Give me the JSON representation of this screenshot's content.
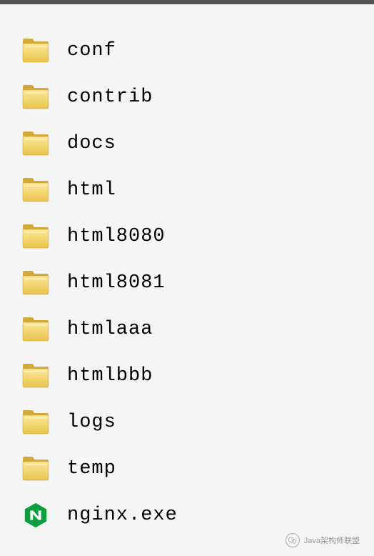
{
  "files": [
    {
      "name": "conf",
      "type": "folder"
    },
    {
      "name": "contrib",
      "type": "folder"
    },
    {
      "name": "docs",
      "type": "folder"
    },
    {
      "name": "html",
      "type": "folder"
    },
    {
      "name": "html8080",
      "type": "folder"
    },
    {
      "name": "html8081",
      "type": "folder"
    },
    {
      "name": "htmlaaa",
      "type": "folder"
    },
    {
      "name": "htmlbbb",
      "type": "folder"
    },
    {
      "name": "logs",
      "type": "folder"
    },
    {
      "name": "temp",
      "type": "folder"
    },
    {
      "name": "nginx.exe",
      "type": "nginx-exe"
    }
  ],
  "watermark": {
    "text": "Java架构师联盟"
  }
}
